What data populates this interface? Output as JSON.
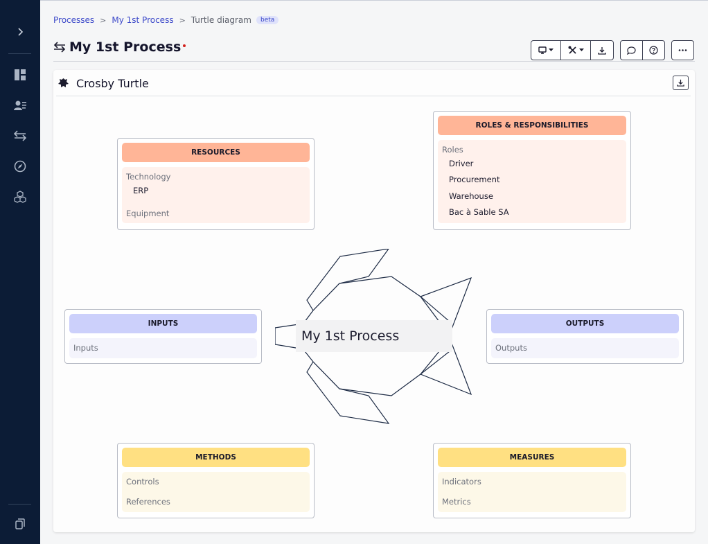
{
  "breadcrumb": {
    "items": [
      "Processes",
      "My 1st Process"
    ],
    "current": "Turtle diagram",
    "badge": "beta"
  },
  "page": {
    "title": "My 1st Process",
    "unsaved_indicator_color": "#d2201c"
  },
  "toolbar": {
    "icons": [
      "monitor-icon",
      "tools-icon",
      "download-icon",
      "comment-icon",
      "help-icon",
      "more-icon"
    ]
  },
  "sidebar": {
    "icons": [
      "expand-icon",
      "dashboard-icon",
      "users-icon",
      "process-icon",
      "compass-icon",
      "modules-icon",
      "copy-icon"
    ]
  },
  "diagram": {
    "title": "Crosby Turtle",
    "center_label": "My 1st Process",
    "resources": {
      "header": "RESOURCES",
      "categories": [
        {
          "name": "Technology",
          "items": [
            "ERP"
          ]
        },
        {
          "name": "Equipment",
          "items": []
        }
      ]
    },
    "roles": {
      "header": "ROLES & RESPONSIBILITIES",
      "category": "Roles",
      "items": [
        "Driver",
        "Procurement",
        "Warehouse",
        "Bac à Sable SA"
      ]
    },
    "inputs": {
      "header": "INPUTS",
      "placeholder": "Inputs"
    },
    "outputs": {
      "header": "OUTPUTS",
      "placeholder": "Outputs"
    },
    "methods": {
      "header": "METHODS",
      "categories": [
        "Controls",
        "References"
      ]
    },
    "measures": {
      "header": "MEASURES",
      "categories": [
        "Indicators",
        "Metrics"
      ]
    }
  },
  "colors": {
    "sidebar": "#0c1c36",
    "link": "#3b48c9",
    "orange_header": "#ffb597",
    "blue_header": "#ccd0fb",
    "yellow_header": "#ffe082"
  }
}
